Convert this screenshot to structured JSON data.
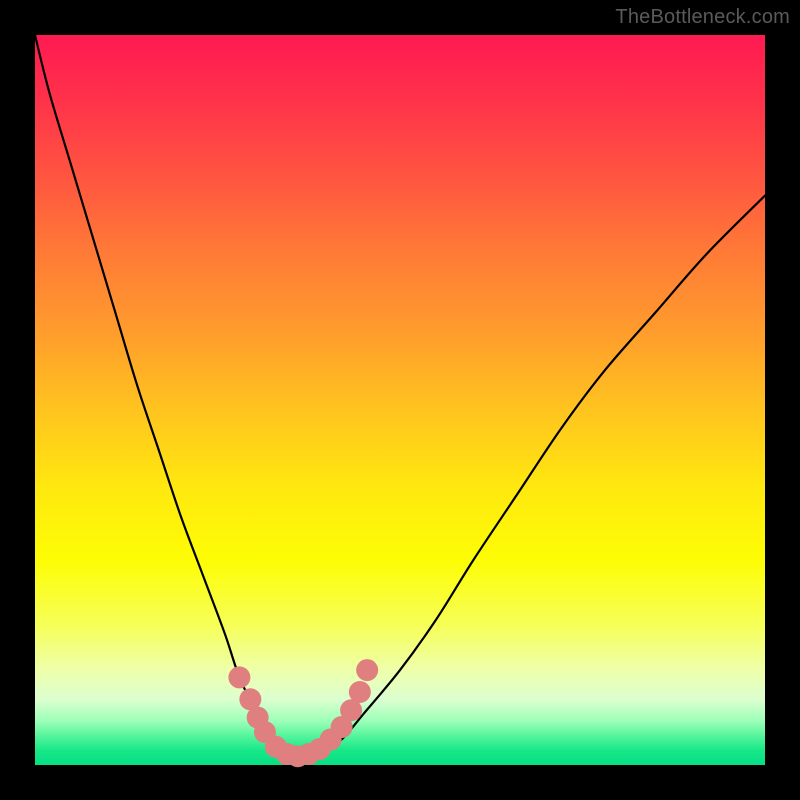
{
  "watermark": "TheBottleneck.com",
  "colors": {
    "background": "#000000",
    "gradient_top": "#ff1a52",
    "gradient_bottom": "#05e083",
    "curve": "#000000",
    "marker": "#e07f7f"
  },
  "chart_data": {
    "type": "line",
    "title": "",
    "xlabel": "",
    "ylabel": "",
    "xlim": [
      0,
      100
    ],
    "ylim": [
      0,
      100
    ],
    "annotations": [
      "TheBottleneck.com"
    ],
    "series": [
      {
        "name": "bottleneck-curve",
        "x": [
          0,
          2,
          5,
          8,
          11,
          14,
          17,
          20,
          23,
          26,
          28,
          30,
          32,
          33.5,
          35,
          37,
          39,
          42,
          45,
          50,
          55,
          60,
          66,
          72,
          78,
          85,
          92,
          100
        ],
        "y": [
          100,
          92,
          82,
          72,
          62,
          52,
          43,
          34,
          26,
          18,
          12,
          8,
          4.5,
          2.5,
          1.2,
          1.0,
          1.5,
          3.5,
          7,
          13,
          20,
          28,
          37,
          46,
          54,
          62,
          70,
          78
        ]
      }
    ],
    "markers": {
      "name": "highlight-points",
      "points": [
        {
          "x": 28.0,
          "y": 12.0
        },
        {
          "x": 29.5,
          "y": 9.0
        },
        {
          "x": 30.5,
          "y": 6.5
        },
        {
          "x": 31.5,
          "y": 4.5
        },
        {
          "x": 33.0,
          "y": 2.5
        },
        {
          "x": 34.5,
          "y": 1.5
        },
        {
          "x": 36.0,
          "y": 1.2
        },
        {
          "x": 37.5,
          "y": 1.5
        },
        {
          "x": 39.0,
          "y": 2.2
        },
        {
          "x": 40.5,
          "y": 3.5
        },
        {
          "x": 42.0,
          "y": 5.2
        },
        {
          "x": 43.3,
          "y": 7.5
        },
        {
          "x": 44.5,
          "y": 10.0
        },
        {
          "x": 45.5,
          "y": 13.0
        }
      ]
    }
  }
}
